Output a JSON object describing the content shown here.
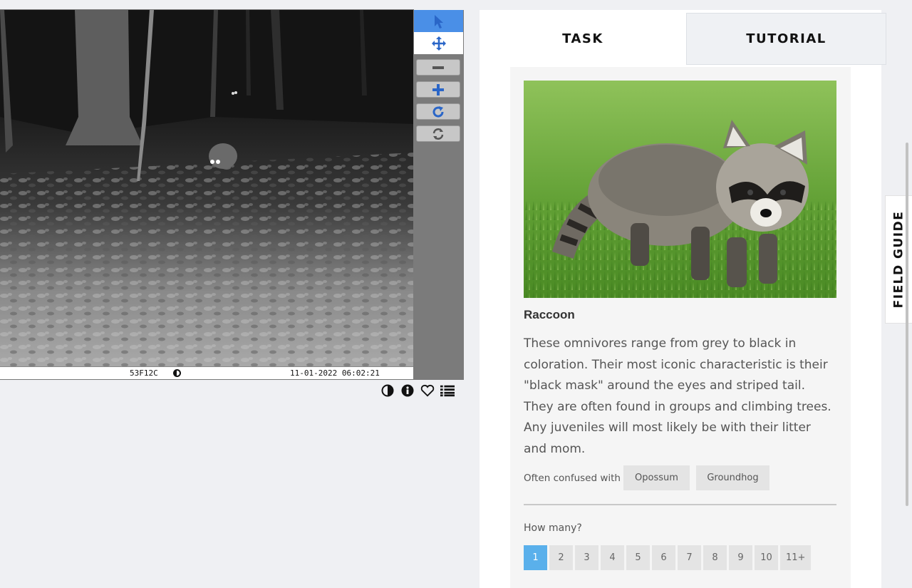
{
  "viewer": {
    "camera_id": "53F12C",
    "timestamp": "11-01-2022 06:02:21",
    "tools": [
      {
        "name": "select-tool",
        "icon": "pointer-icon"
      },
      {
        "name": "pan-tool",
        "icon": "move-arrows-icon"
      },
      {
        "name": "zoom-out-button",
        "icon": "minus-icon"
      },
      {
        "name": "zoom-in-button",
        "icon": "plus-icon"
      },
      {
        "name": "rotate-button",
        "icon": "rotate-icon"
      },
      {
        "name": "reset-button",
        "icon": "refresh-icon"
      }
    ],
    "actions": [
      "contrast-icon",
      "info-icon",
      "heart-icon",
      "list-icon"
    ]
  },
  "tabs": {
    "task": "TASK",
    "tutorial": "TUTORIAL"
  },
  "field_guide": "FIELD GUIDE",
  "species": {
    "name": "Raccoon",
    "description": "These omnivores range from grey to black in coloration. Their most iconic characteristic is their \"black mask\" around the eyes and striped tail. They are often found in groups and climbing trees. Any juveniles will most likely be with their litter and mom.",
    "confused_label": "Often confused with",
    "confused_with": [
      "Opossum",
      "Groundhog"
    ]
  },
  "count": {
    "question": "How many?",
    "options": [
      "1",
      "2",
      "3",
      "4",
      "5",
      "6",
      "7",
      "8",
      "9",
      "10",
      "11+"
    ],
    "selected": "1"
  },
  "colors": {
    "accent_blue": "#4a8fe7",
    "selected_count": "#5ab0eb"
  }
}
